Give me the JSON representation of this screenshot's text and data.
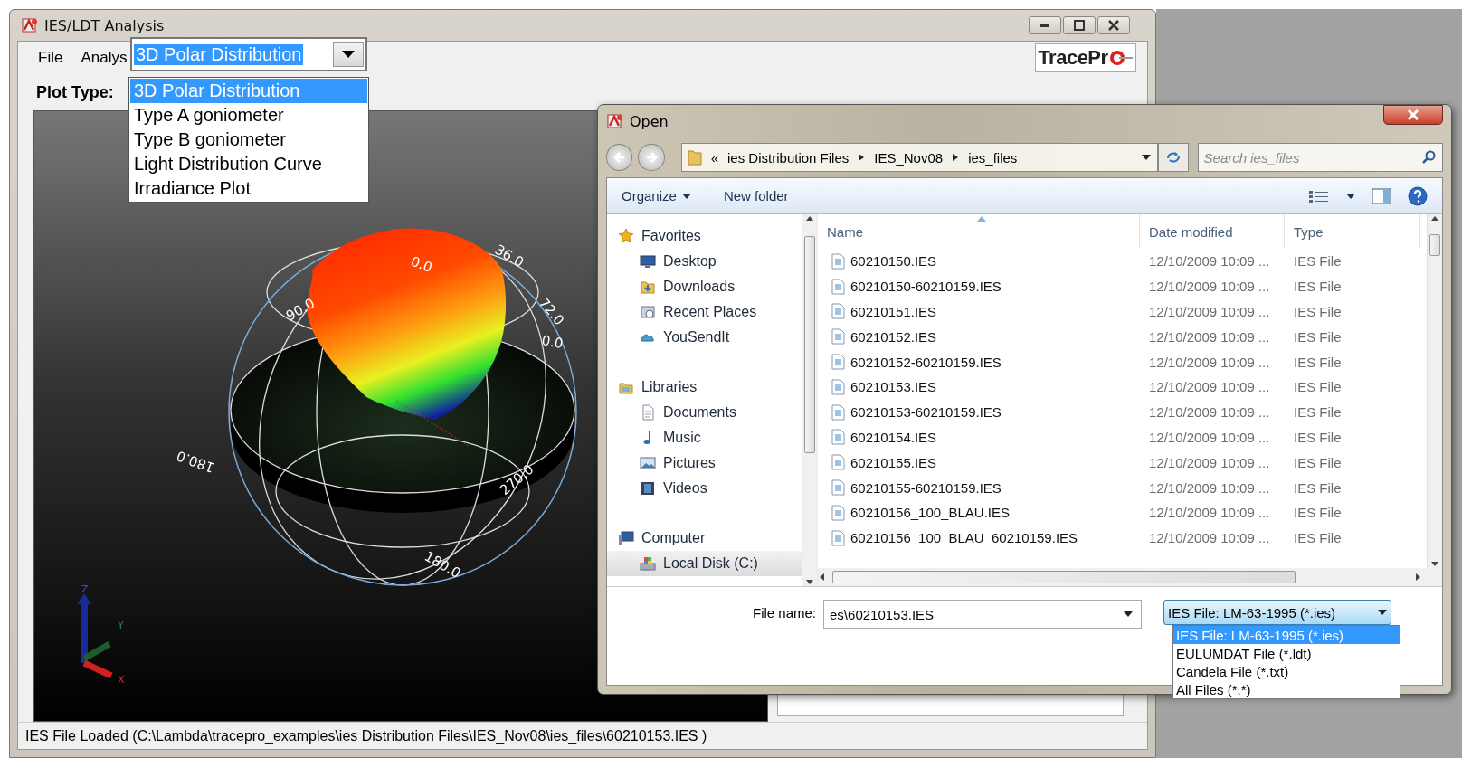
{
  "main_window": {
    "title": "IES/LDT Analysis",
    "menu": [
      "File",
      "Analys"
    ],
    "logo": "TracePr",
    "plot_type_label": "Plot Type:",
    "plot_type_combo": {
      "value": "3D Polar Distribution",
      "options": [
        {
          "label": "3D Polar Distribution",
          "selected": true
        },
        {
          "label": "Type A goniometer",
          "selected": false
        },
        {
          "label": "Type B goniometer",
          "selected": false
        },
        {
          "label": "Light Distribution Curve",
          "selected": false
        },
        {
          "label": "Irradiance Plot",
          "selected": false
        }
      ]
    },
    "plot": {
      "angle_labels": [
        "36.0",
        "0.0",
        "72.0",
        "90.0",
        "0.0",
        "180.0",
        "270.0",
        "180.0"
      ],
      "axis_labels": [
        "Z",
        "Y",
        "X"
      ]
    },
    "status_bar": "IES File Loaded (C:\\Lambda\\tracepro_examples\\ies Distribution Files\\IES_Nov08\\ies_files\\60210153.IES )"
  },
  "open_dialog": {
    "title": "Open",
    "breadcrumb": [
      "«",
      "ies Distribution Files",
      "IES_Nov08",
      "ies_files"
    ],
    "search": {
      "placeholder": "Search ies_files"
    },
    "toolbar": [
      "Organize",
      "New folder"
    ],
    "sidebar": [
      {
        "label": "Favorites",
        "kind": "star",
        "selected": false,
        "children": [
          {
            "label": "Desktop",
            "kind": "desktop",
            "selected": false
          },
          {
            "label": "Downloads",
            "kind": "downloads",
            "selected": false
          },
          {
            "label": "Recent Places",
            "kind": "recent",
            "selected": false
          },
          {
            "label": "YouSendIt",
            "kind": "cloud",
            "selected": false
          }
        ]
      },
      {
        "label": "Libraries",
        "kind": "library",
        "selected": false,
        "children": [
          {
            "label": "Documents",
            "kind": "document",
            "selected": false
          },
          {
            "label": "Music",
            "kind": "music",
            "selected": false
          },
          {
            "label": "Pictures",
            "kind": "picture",
            "selected": false
          },
          {
            "label": "Videos",
            "kind": "video",
            "selected": false
          }
        ]
      },
      {
        "label": "Computer",
        "kind": "computer",
        "selected": false,
        "children": [
          {
            "label": "Local Disk (C:)",
            "kind": "disk",
            "selected": true
          }
        ]
      }
    ],
    "columns": [
      "Name",
      "Date modified",
      "Type"
    ],
    "rows": [
      {
        "name": "60210150.IES",
        "date": "12/10/2009 10:09 ...",
        "type": "IES File"
      },
      {
        "name": "60210150-60210159.IES",
        "date": "12/10/2009 10:09 ...",
        "type": "IES File"
      },
      {
        "name": "60210151.IES",
        "date": "12/10/2009 10:09 ...",
        "type": "IES File"
      },
      {
        "name": "60210152.IES",
        "date": "12/10/2009 10:09 ...",
        "type": "IES File"
      },
      {
        "name": "60210152-60210159.IES",
        "date": "12/10/2009 10:09 ...",
        "type": "IES File"
      },
      {
        "name": "60210153.IES",
        "date": "12/10/2009 10:09 ...",
        "type": "IES File"
      },
      {
        "name": "60210153-60210159.IES",
        "date": "12/10/2009 10:09 ...",
        "type": "IES File"
      },
      {
        "name": "60210154.IES",
        "date": "12/10/2009 10:09 ...",
        "type": "IES File"
      },
      {
        "name": "60210155.IES",
        "date": "12/10/2009 10:09 ...",
        "type": "IES File"
      },
      {
        "name": "60210155-60210159.IES",
        "date": "12/10/2009 10:09 ...",
        "type": "IES File"
      },
      {
        "name": "60210156_100_BLAU.IES",
        "date": "12/10/2009 10:09 ...",
        "type": "IES File"
      },
      {
        "name": "60210156_100_BLAU_60210159.IES",
        "date": "12/10/2009 10:09 ...",
        "type": "IES File"
      }
    ],
    "file_name_label": "File name:",
    "file_name": "es\\60210153.IES",
    "file_type": {
      "value": "IES File: LM-63-1995 (*.ies)",
      "options": [
        {
          "label": "IES File: LM-63-1995 (*.ies)",
          "selected": true
        },
        {
          "label": "EULUMDAT File (*.ldt)",
          "selected": false
        },
        {
          "label": "Candela File (*.txt)",
          "selected": false
        },
        {
          "label": "All Files (*.*)",
          "selected": false
        }
      ]
    }
  }
}
